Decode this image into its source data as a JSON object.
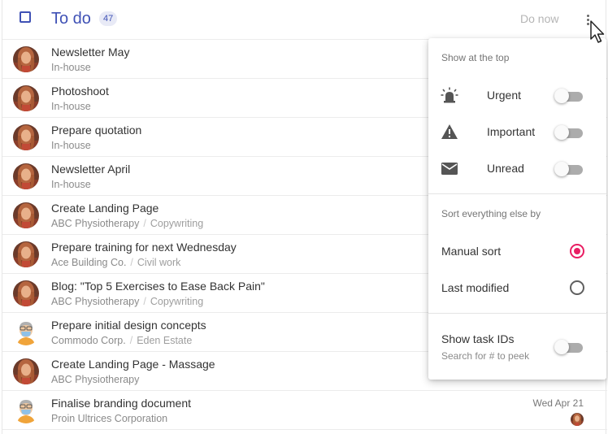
{
  "header": {
    "title": "To do",
    "count": "47",
    "do_now_label": "Do now"
  },
  "tasks": [
    {
      "title": "Newsletter May",
      "client": "In-house",
      "category": "",
      "avatar": "woman-red-hair"
    },
    {
      "title": "Photoshoot",
      "client": "In-house",
      "category": "",
      "avatar": "woman-red-hair"
    },
    {
      "title": "Prepare quotation",
      "client": "In-house",
      "category": "",
      "avatar": "woman-red-hair"
    },
    {
      "title": "Newsletter April",
      "client": "In-house",
      "category": "",
      "avatar": "woman-red-hair"
    },
    {
      "title": "Create Landing Page",
      "client": "ABC Physiotherapy",
      "category": "Copywriting",
      "avatar": "woman-red-hair"
    },
    {
      "title": "Prepare training for next Wednesday",
      "client": "Ace Building Co.",
      "category": "Civil work",
      "avatar": "woman-red-hair"
    },
    {
      "title": "Blog: \"Top 5 Exercises to Ease Back Pain\"",
      "client": "ABC Physiotherapy",
      "category": "Copywriting",
      "avatar": "woman-red-hair"
    },
    {
      "title": "Prepare initial design concepts",
      "client": "Commodo Corp.",
      "category": "Eden Estate",
      "avatar": "man-with-mask"
    },
    {
      "title": "Create Landing Page - Massage",
      "client": "ABC Physiotherapy",
      "category": "",
      "avatar": "woman-red-hair"
    },
    {
      "title": "Finalise branding document",
      "client": "Proin Ultrices Corporation",
      "category": "",
      "avatar": "man-with-mask",
      "date": "Wed Apr 21",
      "assignee_avatar": "woman-red-hair"
    }
  ],
  "menu": {
    "top_heading": "Show at the top",
    "top_items": [
      {
        "label": "Urgent",
        "icon": "siren-icon",
        "enabled": false
      },
      {
        "label": "Important",
        "icon": "warning-icon",
        "enabled": false
      },
      {
        "label": "Unread",
        "icon": "envelope-icon",
        "enabled": false
      }
    ],
    "sort_heading": "Sort everything else by",
    "sort_options": [
      {
        "label": "Manual sort",
        "selected": true
      },
      {
        "label": "Last modified",
        "selected": false
      }
    ],
    "task_ids": {
      "label": "Show task IDs",
      "hint": "Search for # to peek",
      "enabled": false
    }
  },
  "colors": {
    "accent": "#3f51b5",
    "radio_selected": "#e91e63",
    "toggle_off": "#9e9e9e"
  }
}
